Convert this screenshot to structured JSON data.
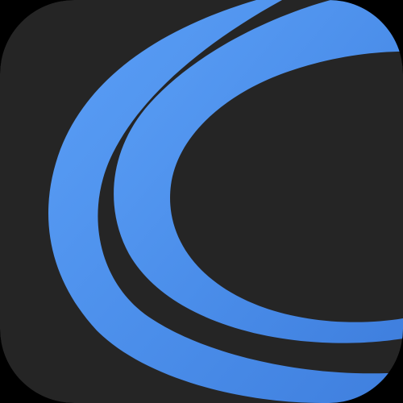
{
  "icon": {
    "name": "app-icon",
    "glyph": "swoosh-c-icon",
    "colors": {
      "background": "#252525",
      "outer_frame": "#000000",
      "accent_light": "#5B9FF6",
      "accent": "#4B8EEA",
      "accent_dark": "#3F7FDE"
    }
  }
}
